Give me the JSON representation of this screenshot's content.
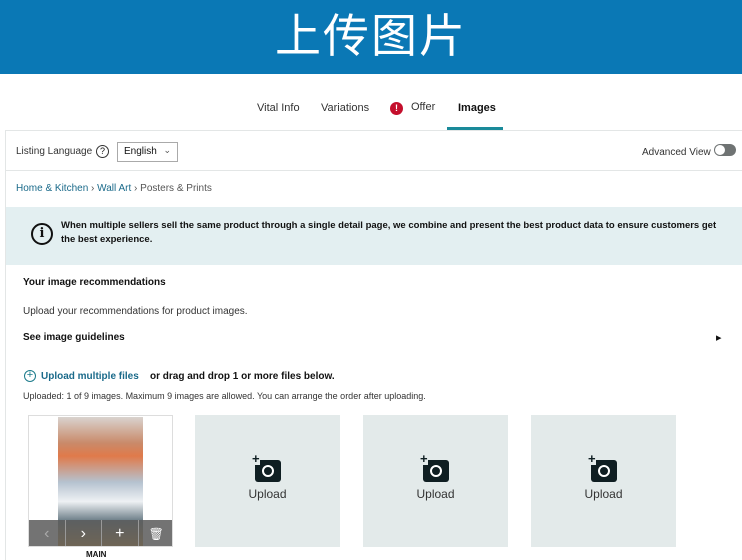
{
  "banner": {
    "title": "上传图片"
  },
  "tabs": [
    {
      "label": "Vital Info"
    },
    {
      "label": "Variations"
    },
    {
      "label": "Offer",
      "alert": "!"
    },
    {
      "label": "Images",
      "active": true
    }
  ],
  "listing": {
    "label": "Listing Language",
    "help": "?",
    "language": "English",
    "advanced_view": "Advanced View"
  },
  "breadcrumb": [
    "Home & Kitchen",
    "Wall Art",
    "Posters & Prints"
  ],
  "info": {
    "icon": "i",
    "text": "When multiple sellers sell the same product through a single detail page, we combine and present the best product data to ensure customers get the best experience."
  },
  "recommendations": {
    "title": "Your image recommendations",
    "subtitle": "Upload your recommendations for product images.",
    "guidelines": "See image guidelines",
    "guidelines_arrow": "▸"
  },
  "upload": {
    "link": "Upload multiple files",
    "drag": "or drag and drop 1 or more files below.",
    "status": "Uploaded: 1 of 9 images. Maximum 9 images are allowed. You can arrange the order after uploading.",
    "tile_label": "Upload",
    "main_label": "MAIN"
  },
  "controls": {
    "prev": "‹",
    "next": "›",
    "add": "+",
    "delete": "🗑"
  }
}
